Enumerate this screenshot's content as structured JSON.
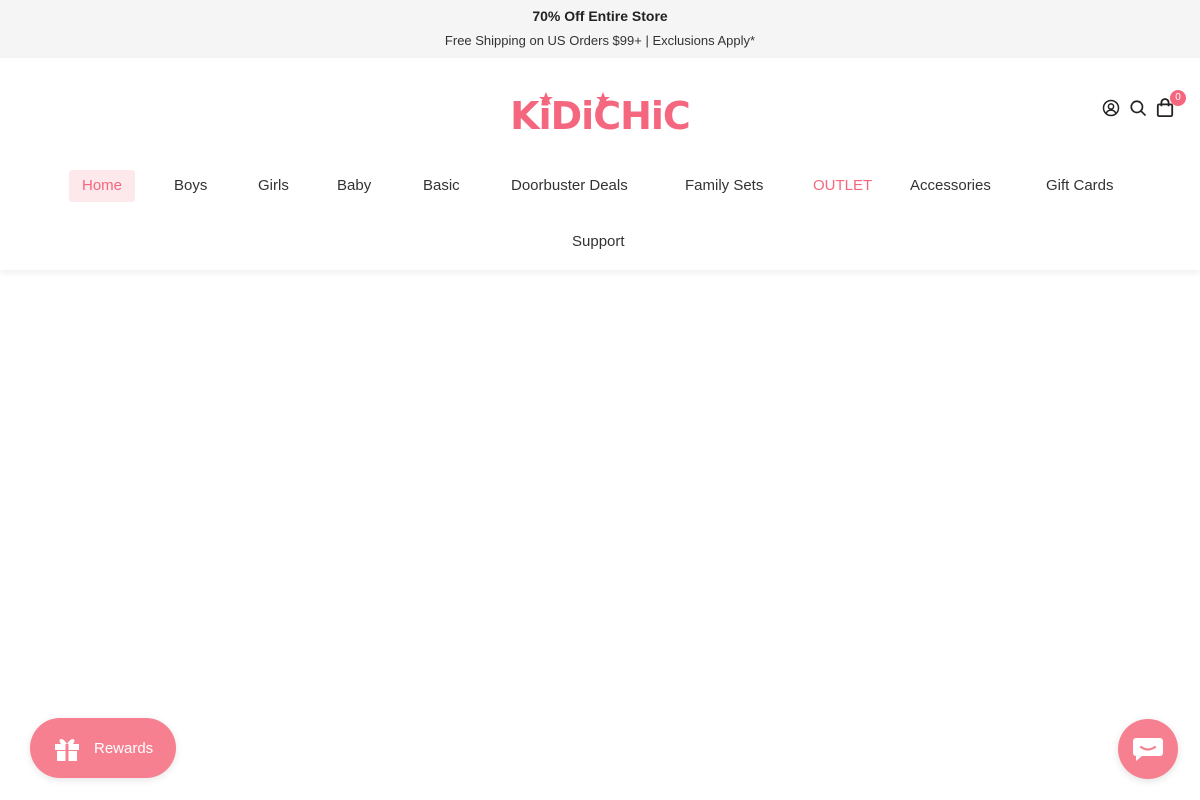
{
  "announcement": {
    "headline": "70% Off Entire Store",
    "subline": "Free Shipping on US Orders $99+ | Exclusions Apply*"
  },
  "header": {
    "logo_text": "KiDiCHiC",
    "cart_count": "0",
    "icons": [
      "account-icon",
      "search-icon",
      "cart-icon"
    ]
  },
  "nav": {
    "items": [
      {
        "label": "Home"
      },
      {
        "label": "Boys"
      },
      {
        "label": "Girls"
      },
      {
        "label": "Baby"
      },
      {
        "label": "Basic"
      },
      {
        "label": "Doorbuster Deals"
      },
      {
        "label": "Family Sets"
      },
      {
        "label": "OUTLET"
      },
      {
        "label": "Accessories"
      },
      {
        "label": "Gift Cards"
      },
      {
        "label": "Support"
      }
    ]
  },
  "widgets": {
    "rewards_label": "Rewards",
    "chat_icon": "chat-icon"
  },
  "colors": {
    "brand": "#f4677f",
    "announcement_bg": "#f5f5f5",
    "active_nav_bg": "#fde9ec",
    "widget_bg": "#f6808f"
  }
}
